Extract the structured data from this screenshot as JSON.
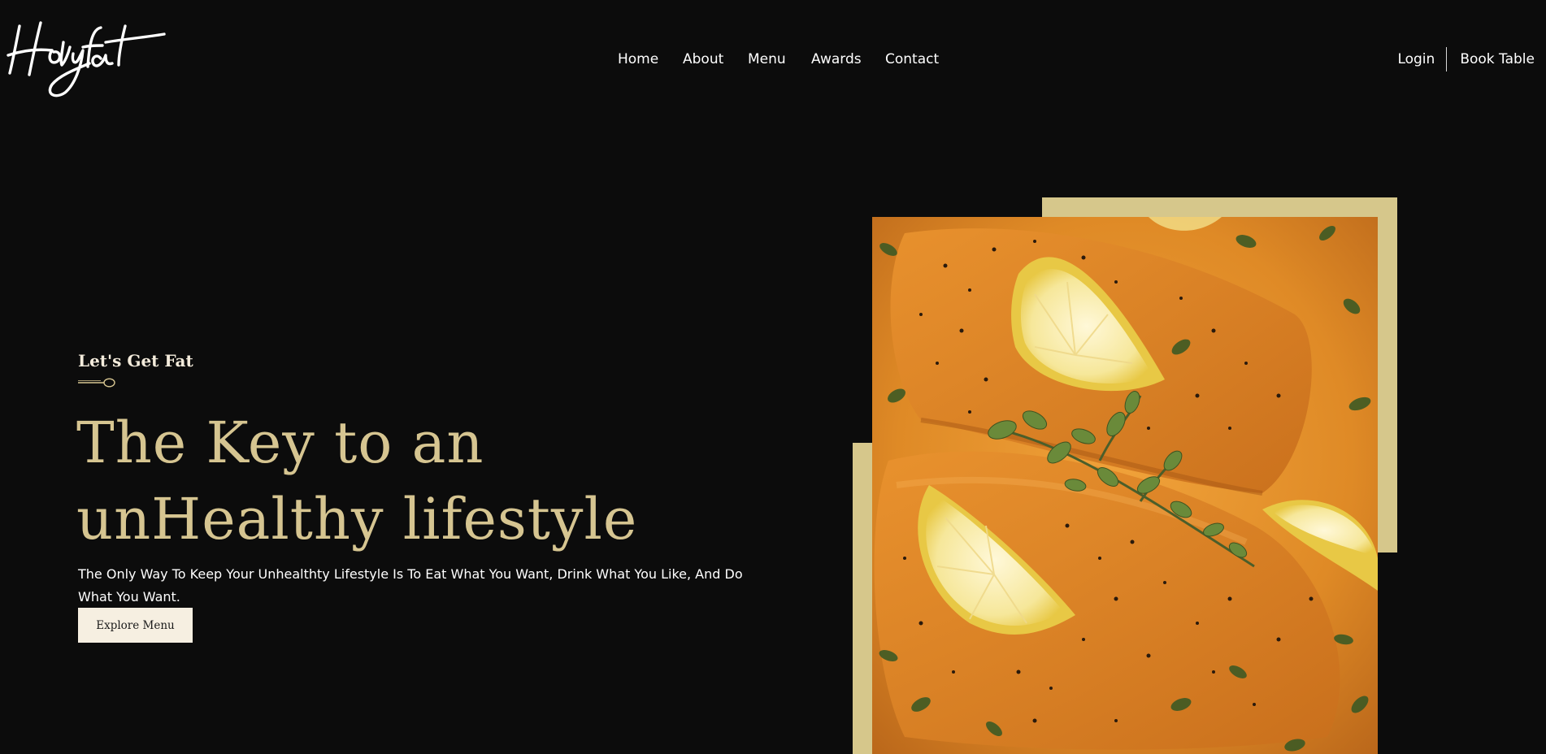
{
  "brand": {
    "logo_text": "Holyfat",
    "logo_icon": "script-wordmark-logo"
  },
  "nav": {
    "items": [
      {
        "label": "Home"
      },
      {
        "label": "About"
      },
      {
        "label": "Menu"
      },
      {
        "label": "Awards"
      },
      {
        "label": "Contact"
      }
    ]
  },
  "auth": {
    "login_label": "Login",
    "book_label": "Book Table"
  },
  "hero": {
    "eyebrow": "Let's Get Fat",
    "eyebrow_icon": "spoon-icon",
    "title_line1": "The Key to an",
    "title_line2": "unHealthy lifestyle",
    "description": "The Only Way To Keep Your Unhealthty Lifestyle Is To Eat What You Want, Drink What You Like, And Do What You Want.",
    "cta_label": "Explore Menu",
    "image_subject": "salmon-fillets-with-lemon-and-oregano"
  },
  "colors": {
    "background": "#0c0c0c",
    "accent_gold": "#d6c591",
    "frame_gold": "#d6c78b",
    "button_bg": "#f6efe1",
    "text": "#ffffff"
  }
}
